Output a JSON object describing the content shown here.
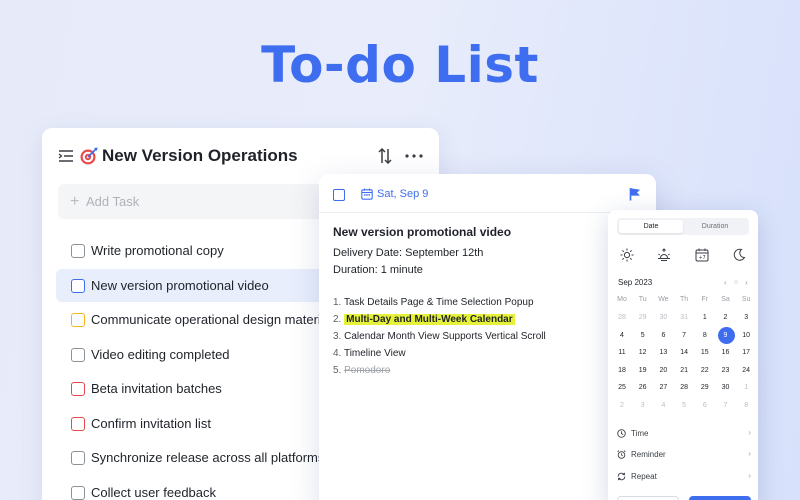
{
  "hero_title": "To-do List",
  "list_panel": {
    "emoji_icon": "dart-target-icon",
    "title": "New Version Operations",
    "add_task_placeholder": "Add Task",
    "tasks": [
      {
        "label": "Write promotional copy",
        "checkbox_color": "#8c9099",
        "selected": false
      },
      {
        "label": "New version promotional video",
        "checkbox_color": "#3e6df0",
        "selected": true
      },
      {
        "label": "Communicate operational design materials",
        "checkbox_color": "#f3b31b",
        "selected": false
      },
      {
        "label": "Video editing completed",
        "checkbox_color": "#8c9099",
        "selected": false
      },
      {
        "label": "Beta invitation batches",
        "checkbox_color": "#e5484d",
        "selected": false
      },
      {
        "label": "Confirm invitation list",
        "checkbox_color": "#e5484d",
        "selected": false
      },
      {
        "label": "Synchronize release across all platforms",
        "checkbox_color": "#8c9099",
        "selected": false
      },
      {
        "label": "Collect user feedback",
        "checkbox_color": "#8c9099",
        "selected": false
      }
    ]
  },
  "detail_panel": {
    "date": "Sat, Sep 9",
    "title": "New version promotional video",
    "delivery": "Delivery Date: September 12th",
    "duration": "Duration: 1 minute",
    "items": [
      {
        "num": "1.",
        "text": "Task Details Page & Time Selection Popup"
      },
      {
        "num": "2.",
        "text": "Multi-Day and Multi-Week Calendar",
        "highlight": true
      },
      {
        "num": "3.",
        "text": "Calendar Month View Supports Vertical Scroll"
      },
      {
        "num": "4.",
        "text": "Timeline View"
      },
      {
        "num": "5.",
        "text": "Pomodoro",
        "done": true
      }
    ]
  },
  "calendar": {
    "tabs": [
      "Date",
      "Duration"
    ],
    "active_tab": "Date",
    "quick_icons": [
      "sun-icon",
      "sunrise-icon",
      "next-week-calendar-icon",
      "moon-icon"
    ],
    "month": "Sep 2023",
    "weekdays": [
      "Mo",
      "Tu",
      "We",
      "Th",
      "Fr",
      "Sa",
      "Su"
    ],
    "weeks": [
      [
        "28",
        "29",
        "30",
        "31",
        "1",
        "2",
        "3"
      ],
      [
        "4",
        "5",
        "6",
        "7",
        "8",
        "9",
        "10"
      ],
      [
        "11",
        "12",
        "13",
        "14",
        "15",
        "16",
        "17"
      ],
      [
        "18",
        "19",
        "20",
        "21",
        "22",
        "23",
        "24"
      ],
      [
        "25",
        "26",
        "27",
        "28",
        "29",
        "30",
        "1"
      ],
      [
        "2",
        "3",
        "4",
        "5",
        "6",
        "7",
        "8"
      ]
    ],
    "selected_day": "9",
    "options": [
      "Time",
      "Reminder",
      "Repeat"
    ],
    "accent": "#3e6df0"
  }
}
